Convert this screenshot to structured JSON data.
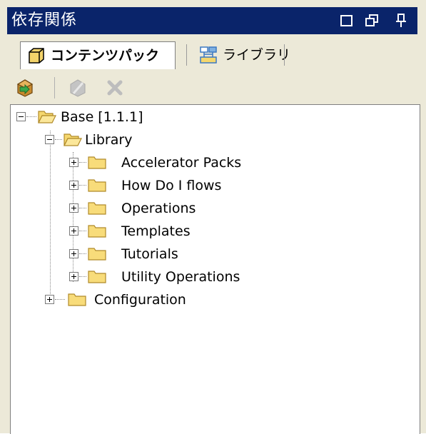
{
  "window": {
    "title": "依存関係",
    "maximize_icon": "maximize-icon",
    "restore_icon": "restore-icon",
    "pin_icon": "pin-icon"
  },
  "tabs": [
    {
      "label": "コンテンツパック",
      "icon": "content-pack-icon",
      "active": true
    },
    {
      "label": "ライブラリ",
      "icon": "library-icon",
      "active": false
    }
  ],
  "toolbar": {
    "install_icon": "install-icon",
    "disabled_icon": "disabled-action-icon",
    "delete_icon": "delete-icon"
  },
  "tree": {
    "root": {
      "label": "Base [1.1.1]",
      "expanded": true
    },
    "library": {
      "label": "Library",
      "expanded": true
    },
    "library_children": [
      {
        "label": "Accelerator Packs"
      },
      {
        "label": "How Do I flows"
      },
      {
        "label": "Operations"
      },
      {
        "label": "Templates"
      },
      {
        "label": "Tutorials"
      },
      {
        "label": "Utility Operations"
      }
    ],
    "configuration": {
      "label": "Configuration",
      "expanded": false
    }
  },
  "colors": {
    "titlebar": "#0a246a",
    "panel": "#ece9d8",
    "folder": "#f5d76e"
  }
}
